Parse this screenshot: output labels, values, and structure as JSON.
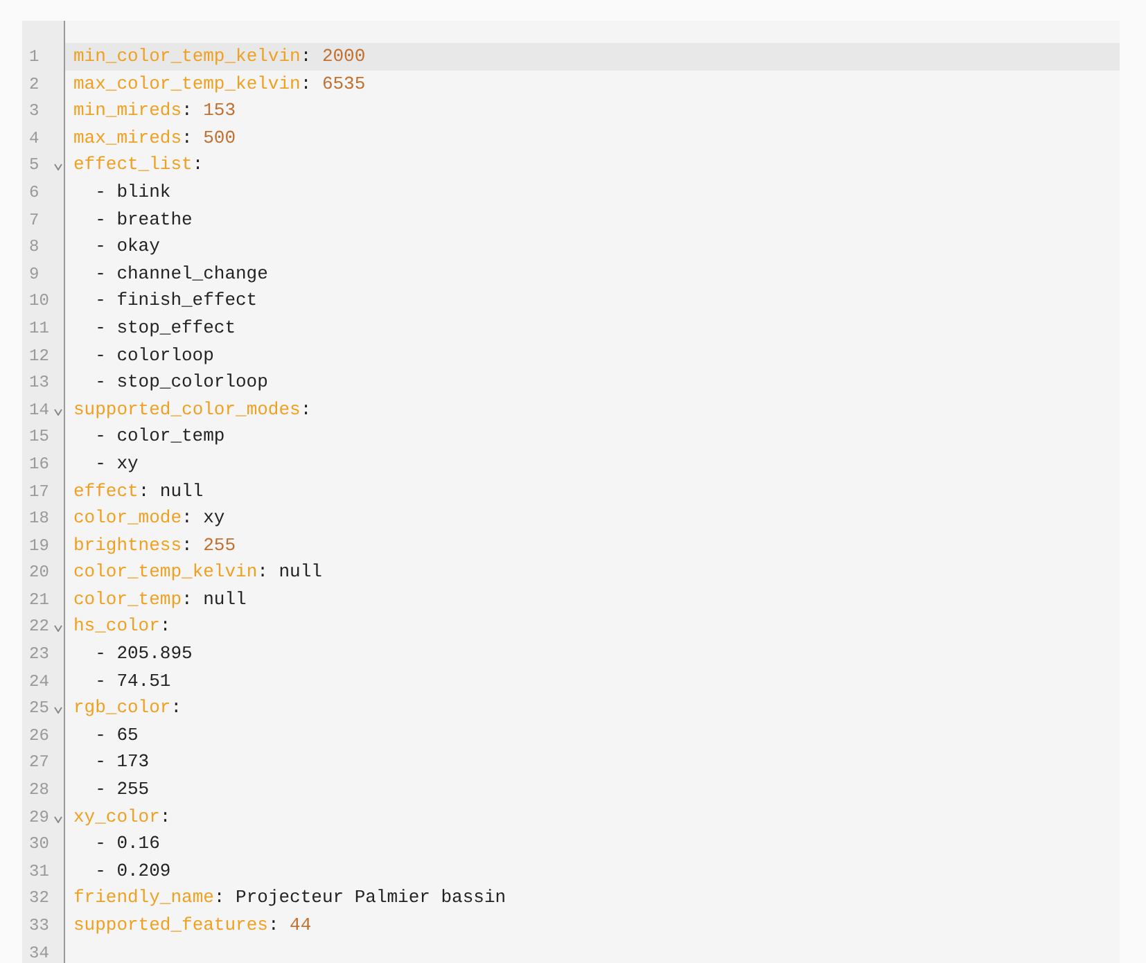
{
  "editor": {
    "lines": [
      {
        "number": "1",
        "key": "min_color_temp_kelvin",
        "sep": ": ",
        "value": "2000",
        "numeric": true,
        "active": true
      },
      {
        "number": "2",
        "key": "max_color_temp_kelvin",
        "sep": ": ",
        "value": "6535",
        "numeric": true,
        "active": false
      },
      {
        "number": "3",
        "key": "min_mireds",
        "sep": ": ",
        "value": "153",
        "numeric": true,
        "active": false
      },
      {
        "number": "4",
        "key": "max_mireds",
        "sep": ": ",
        "value": "500",
        "numeric": true,
        "active": false
      },
      {
        "number": "5",
        "key": "effect_list",
        "sep": ":",
        "active": false,
        "expanded": true,
        "children": [
          {
            "number": "6",
            "text": "- blink",
            "active": false
          },
          {
            "number": "7",
            "text": "- breathe",
            "active": false
          },
          {
            "number": "8",
            "text": "- okay",
            "active": false
          },
          {
            "number": "9",
            "text": "- channel_change",
            "active": false
          },
          {
            "number": "10",
            "text": "- finish_effect",
            "active": false
          },
          {
            "number": "11",
            "text": "- stop_effect",
            "active": false
          },
          {
            "number": "12",
            "text": "- colorloop",
            "active": false
          },
          {
            "number": "13",
            "text": "- stop_colorloop",
            "active": false
          }
        ]
      },
      {
        "number": "14",
        "key": "supported_color_modes",
        "sep": ":",
        "active": false,
        "expanded": true,
        "children": [
          {
            "number": "15",
            "text": "- color_temp",
            "active": false
          },
          {
            "number": "16",
            "text": "- xy",
            "active": false
          }
        ]
      },
      {
        "number": "17",
        "key": "effect",
        "sep": ": ",
        "value": "null",
        "numeric": false,
        "active": false
      },
      {
        "number": "18",
        "key": "color_mode",
        "sep": ": ",
        "value": "xy",
        "numeric": false,
        "active": false
      },
      {
        "number": "19",
        "key": "brightness",
        "sep": ": ",
        "value": "255",
        "numeric": true,
        "active": false
      },
      {
        "number": "20",
        "key": "color_temp_kelvin",
        "sep": ": ",
        "value": "null",
        "numeric": false,
        "active": false
      },
      {
        "number": "21",
        "key": "color_temp",
        "sep": ": ",
        "value": "null",
        "numeric": false,
        "active": false
      },
      {
        "number": "22",
        "key": "hs_color",
        "sep": ":",
        "active": false,
        "expanded": true,
        "children": [
          {
            "number": "23",
            "text": "- 205.895",
            "active": false
          },
          {
            "number": "24",
            "text": "- 74.51",
            "active": false
          }
        ]
      },
      {
        "number": "25",
        "key": "rgb_color",
        "sep": ":",
        "active": false,
        "expanded": true,
        "children": [
          {
            "number": "26",
            "text": "- 65",
            "active": false
          },
          {
            "number": "27",
            "text": "- 173",
            "active": false
          },
          {
            "number": "28",
            "text": "- 255",
            "active": false
          }
        ]
      },
      {
        "number": "29",
        "key": "xy_color",
        "sep": ":",
        "active": false,
        "expanded": true,
        "children": [
          {
            "number": "30",
            "text": "- 0.16",
            "active": false
          },
          {
            "number": "31",
            "text": "- 0.209",
            "active": false
          }
        ]
      },
      {
        "number": "32",
        "key": "friendly_name",
        "sep": ": ",
        "value": "Projecteur Palmier bassin",
        "numeric": false,
        "active": false
      },
      {
        "number": "33",
        "key": "supported_features",
        "sep": ": ",
        "value": "44",
        "numeric": true,
        "active": false
      },
      {
        "number": "34",
        "active": false
      }
    ]
  }
}
